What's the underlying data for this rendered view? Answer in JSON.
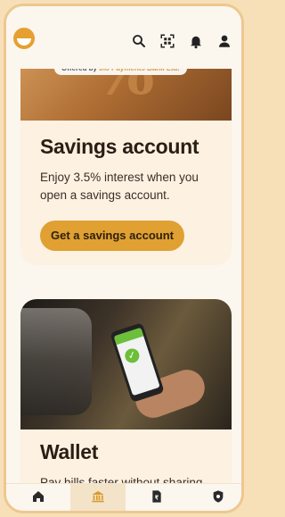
{
  "top_bar": {
    "logo_icon": "jio-logo-icon",
    "icons": [
      "search-icon",
      "qr-scan-icon",
      "bell-icon",
      "profile-icon"
    ]
  },
  "savings_card": {
    "badge_prefix": "Offered by",
    "badge_brand": "Jio Payments Bank Ltd.",
    "title": "Savings account",
    "description": "Enjoy 3.5% interest when you open a savings account.",
    "cta_label": "Get a savings account"
  },
  "wallet_card": {
    "title": "Wallet",
    "description": "Pay bills faster without sharing"
  },
  "bottom_nav": {
    "items": [
      "home-icon",
      "bank-icon",
      "document-icon",
      "shield-icon"
    ],
    "active_index": 1
  },
  "colors": {
    "accent": "#e0a032",
    "background": "#fbf6ee",
    "card": "#fdf1e2",
    "frame": "#eec790"
  }
}
